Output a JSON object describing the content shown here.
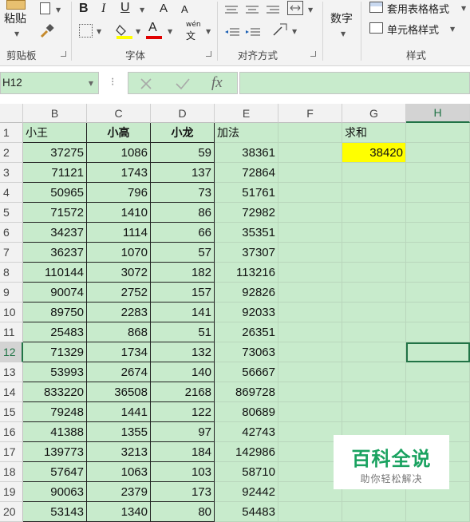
{
  "ribbon": {
    "paste_label": "粘贴",
    "clipboard_group": "剪贴板",
    "font_group": "字体",
    "align_group": "对齐方式",
    "style_group": "样式",
    "number_label": "数字",
    "table_style_label": "套用表格格式",
    "cell_style_label": "单元格样式",
    "bold": "B",
    "italic": "I",
    "underline": "U",
    "phonetic_top": "wén",
    "phonetic_bottom": "文",
    "font_color_letter": "A",
    "increase_font": "A",
    "decrease_font": "A",
    "fill_color": "#ffff00",
    "font_color": "#e00000"
  },
  "formula_bar": {
    "name_box": "H12",
    "fx_label": "fx",
    "formula_value": ""
  },
  "sheet": {
    "columns": [
      "B",
      "C",
      "D",
      "E",
      "F",
      "G",
      "H"
    ],
    "selected_column": "H",
    "selected_row": "12",
    "headers": [
      "小王",
      "小高",
      "小龙",
      "加法"
    ],
    "sum_label": "求和",
    "sum_value": "38420",
    "rows": [
      {
        "n": "1"
      },
      {
        "n": "2",
        "b": "37275",
        "c": "1086",
        "d": "59",
        "e": "38361"
      },
      {
        "n": "3",
        "b": "71121",
        "c": "1743",
        "d": "137",
        "e": "72864"
      },
      {
        "n": "4",
        "b": "50965",
        "c": "796",
        "d": "73",
        "e": "51761"
      },
      {
        "n": "5",
        "b": "71572",
        "c": "1410",
        "d": "86",
        "e": "72982"
      },
      {
        "n": "6",
        "b": "34237",
        "c": "1114",
        "d": "66",
        "e": "35351"
      },
      {
        "n": "7",
        "b": "36237",
        "c": "1070",
        "d": "57",
        "e": "37307"
      },
      {
        "n": "8",
        "b": "110144",
        "c": "3072",
        "d": "182",
        "e": "113216"
      },
      {
        "n": "9",
        "b": "90074",
        "c": "2752",
        "d": "157",
        "e": "92826"
      },
      {
        "n": "10",
        "b": "89750",
        "c": "2283",
        "d": "141",
        "e": "92033"
      },
      {
        "n": "11",
        "b": "25483",
        "c": "868",
        "d": "51",
        "e": "26351"
      },
      {
        "n": "12",
        "b": "71329",
        "c": "1734",
        "d": "132",
        "e": "73063"
      },
      {
        "n": "13",
        "b": "53993",
        "c": "2674",
        "d": "140",
        "e": "56667"
      },
      {
        "n": "14",
        "b": "833220",
        "c": "36508",
        "d": "2168",
        "e": "869728"
      },
      {
        "n": "15",
        "b": "79248",
        "c": "1441",
        "d": "122",
        "e": "80689"
      },
      {
        "n": "16",
        "b": "41388",
        "c": "1355",
        "d": "97",
        "e": "42743"
      },
      {
        "n": "17",
        "b": "139773",
        "c": "3213",
        "d": "184",
        "e": "142986"
      },
      {
        "n": "18",
        "b": "57647",
        "c": "1063",
        "d": "103",
        "e": "58710"
      },
      {
        "n": "19",
        "b": "90063",
        "c": "2379",
        "d": "173",
        "e": "92442"
      },
      {
        "n": "20",
        "b": "53143",
        "c": "1340",
        "d": "80",
        "e": "54483"
      }
    ]
  },
  "watermark": {
    "title": "百科全说",
    "subtitle": "助你轻松解决"
  }
}
